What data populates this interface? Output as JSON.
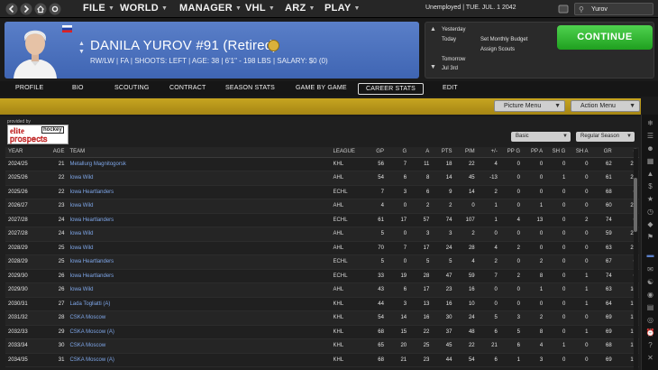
{
  "topbar": {
    "menus": [
      "FILE",
      "WORLD",
      "MANAGER",
      "VHL",
      "ARZ",
      "PLAY"
    ],
    "status": "Unemployed | TUE. JUL. 1 2042",
    "search_value": "Yurov"
  },
  "player": {
    "name": "DANILA YUROV #91 (Retired)",
    "info": "RW/LW | FA | SHOOTS: LEFT | AGE: 38 | 6'1\" - 198 LBS | SALARY: $0 (0)",
    "nationality": "Russia"
  },
  "calendar": {
    "yesterday": "Yesterday",
    "today": "Today",
    "tomorrow": "Tomorrow",
    "tomorrow_date": "Jul 3rd",
    "task1": "Set Monthly Budget",
    "task2": "Assign Scouts",
    "continue_label": "CONTINUE"
  },
  "tabs": [
    "PROFILE",
    "BIO",
    "SCOUTING",
    "CONTRACT",
    "SEASON STATS",
    "GAME BY GAME",
    "CAREER STATS",
    "EDIT"
  ],
  "active_tab": "CAREER STATS",
  "toolbar": {
    "picture_menu": "Picture Menu",
    "action_menu": "Action Menu"
  },
  "source": {
    "provided_by": "provided by",
    "logo_elite": "elite",
    "logo_hockey": "hockey",
    "logo_prospects": "prospects"
  },
  "filters": {
    "stat_type": "Basic",
    "season_type": "Regular Season"
  },
  "table": {
    "columns": [
      "YEAR",
      "AGE",
      "TEAM",
      "LEAGUE",
      "GP",
      "G",
      "A",
      "PTS",
      "PIM",
      "+/-",
      "PP G",
      "PP A",
      "SH G",
      "SH A",
      "GR",
      "#"
    ],
    "rows": [
      [
        "2024/25",
        "21",
        "Metallurg Magnitogorsk",
        "KHL",
        "56",
        "7",
        "11",
        "18",
        "22",
        "4",
        "0",
        "0",
        "0",
        "0",
        "62",
        "22"
      ],
      [
        "2025/26",
        "22",
        "Iowa Wild",
        "AHL",
        "54",
        "6",
        "8",
        "14",
        "45",
        "-13",
        "0",
        "0",
        "1",
        "0",
        "61",
        "22"
      ],
      [
        "2025/26",
        "22",
        "Iowa Heartlanders",
        "ECHL",
        "7",
        "3",
        "6",
        "9",
        "14",
        "2",
        "0",
        "0",
        "0",
        "0",
        "68",
        "0"
      ],
      [
        "2026/27",
        "23",
        "Iowa Wild",
        "AHL",
        "4",
        "0",
        "2",
        "2",
        "0",
        "1",
        "0",
        "1",
        "0",
        "0",
        "60",
        "22"
      ],
      [
        "2027/28",
        "24",
        "Iowa Heartlanders",
        "ECHL",
        "61",
        "17",
        "57",
        "74",
        "107",
        "1",
        "4",
        "13",
        "0",
        "2",
        "74",
        "0"
      ],
      [
        "2027/28",
        "24",
        "Iowa Wild",
        "AHL",
        "5",
        "0",
        "3",
        "3",
        "2",
        "0",
        "0",
        "0",
        "0",
        "0",
        "59",
        "22"
      ],
      [
        "2028/29",
        "25",
        "Iowa Wild",
        "AHL",
        "70",
        "7",
        "17",
        "24",
        "28",
        "4",
        "2",
        "0",
        "0",
        "0",
        "63",
        "22"
      ],
      [
        "2028/29",
        "25",
        "Iowa Heartlanders",
        "ECHL",
        "5",
        "0",
        "5",
        "5",
        "4",
        "2",
        "0",
        "2",
        "0",
        "0",
        "67",
        "0"
      ],
      [
        "2029/30",
        "26",
        "Iowa Heartlanders",
        "ECHL",
        "33",
        "19",
        "28",
        "47",
        "59",
        "7",
        "2",
        "8",
        "0",
        "1",
        "74",
        "0"
      ],
      [
        "2029/30",
        "26",
        "Iowa Wild",
        "AHL",
        "43",
        "6",
        "17",
        "23",
        "16",
        "0",
        "0",
        "1",
        "0",
        "1",
        "63",
        "10"
      ],
      [
        "2030/31",
        "27",
        "Lada Togliatti (A)",
        "KHL",
        "44",
        "3",
        "13",
        "16",
        "10",
        "0",
        "0",
        "0",
        "0",
        "1",
        "64",
        "19"
      ],
      [
        "2031/32",
        "28",
        "CSKA Moscow",
        "KHL",
        "54",
        "14",
        "16",
        "30",
        "24",
        "5",
        "3",
        "2",
        "0",
        "0",
        "69",
        "19"
      ],
      [
        "2032/33",
        "29",
        "CSKA Moscow (A)",
        "KHL",
        "68",
        "15",
        "22",
        "37",
        "48",
        "6",
        "5",
        "8",
        "0",
        "1",
        "69",
        "19"
      ],
      [
        "2033/34",
        "30",
        "CSKA Moscow",
        "KHL",
        "65",
        "20",
        "25",
        "45",
        "22",
        "21",
        "6",
        "4",
        "1",
        "0",
        "68",
        "19"
      ],
      [
        "2034/35",
        "31",
        "CSKA Moscow (A)",
        "KHL",
        "68",
        "21",
        "23",
        "44",
        "54",
        "6",
        "1",
        "3",
        "0",
        "0",
        "69",
        "19"
      ]
    ]
  }
}
